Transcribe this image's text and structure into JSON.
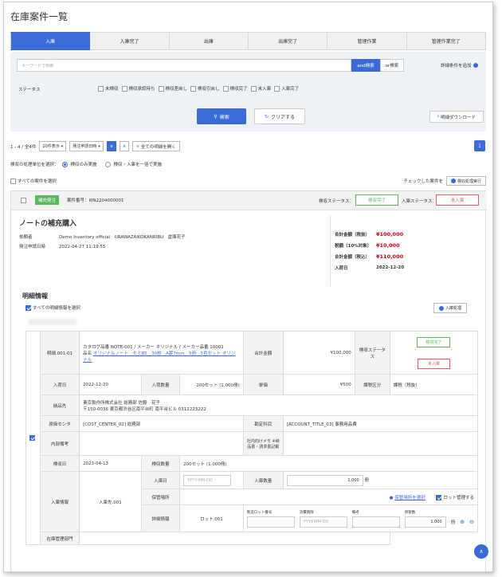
{
  "page": {
    "title": "在庫案件一覧"
  },
  "tabs": [
    {
      "label": "入庫"
    },
    {
      "label": "入庫完了"
    },
    {
      "label": "出庫"
    },
    {
      "label": "出庫完了"
    },
    {
      "label": "管理作業"
    },
    {
      "label": "管理作業完了"
    }
  ],
  "search": {
    "placeholder": "キーワードで検索",
    "and_label": "and検索",
    "or_label": "or検索",
    "advanced_label": "詳細条件を追加",
    "status_label": "ステータス",
    "status_options": [
      "未検収",
      "検収承認待ち",
      "検収差戻し",
      "検収引戻し",
      "検収完了",
      "未入庫",
      "入庫完了"
    ],
    "search_button": "検索",
    "clear_button": "クリアする",
    "download_button": "明細ダウンロード"
  },
  "listing": {
    "range_text": "1 - 4 / 全4件",
    "per_page": "20件表示",
    "sort": "発注申請日時",
    "open_all": "全ての明細を開く",
    "page_number": "1",
    "unit_label": "検収の処理単位を選択：",
    "unit_option_1": "検収のみ実施",
    "unit_option_2": "検収・入庫を一括で実施",
    "select_all_cases": "すべての案件を選択",
    "checked_cases": "チェックした案件を",
    "inspect_button": "検収処理実行"
  },
  "case": {
    "badge": "補充発注",
    "case_no": "案件番号：IIIN2204000001",
    "inspect_status_label": "検収ステータス：",
    "inspect_status": "検収完了",
    "receive_status_label": "入庫ステータス：",
    "receive_status": "未入庫",
    "title": "ノートの補充購入",
    "requester_label": "依頼者",
    "requester": "Demo Inventory official　URAWAZAIKOKANRIBU　倉庫花子",
    "ordered_at_label": "発注申請日時",
    "ordered_at": "2022-04-27 11:19:55",
    "totals": {
      "subtotal_label": "合計金額（税抜）",
      "subtotal": "¥100,000",
      "tax_label": "税額（10%対象）",
      "tax": "¥10,000",
      "total_label": "合計金額（税込）",
      "total": "¥110,000",
      "arrival_label": "入荷日",
      "arrival": "2022-12-20"
    }
  },
  "detail": {
    "heading": "明細情報",
    "select_all": "すべての明細情報を選択",
    "receive_button": "入庫処理",
    "row": {
      "detail_no_label": "明細.001-01",
      "product_line1": "カタログ品番 NOTE-001 / メーカー オリジナル / メーカー品番 10001",
      "product_name_prefix": "品名",
      "product_name": "オリジナルノート　セミB5　30枚　A罫7mm　5冊　5色セット オリジナル",
      "amount_label": "合計金額",
      "amount": "¥100,000",
      "inspect_status_label": "検収ステータス",
      "inspect_status": "検収完了",
      "receive_status_label": "入庫ステータス",
      "receive_status": "未入庫",
      "arrival_label": "入荷日",
      "arrival": "2022-12-20",
      "arrival_qty_label": "入荷数量",
      "arrival_qty": "200セット (1,000冊)",
      "unit_price_label": "単価",
      "unit_price": "¥500",
      "tax_class_label": "課税区分",
      "tax_class": "課税（税抜）",
      "delivery_label": "納品先",
      "delivery": "東京製作所株式会社 総務部 佐藤　花子",
      "delivery_address": "〒150-0036 東京都渋谷区南平台町 南平台ビル 0312223222",
      "cost_center_label": "原価センタ",
      "cost_center": "[COST_CENTER_02] 総務部",
      "account_label": "勘定科目",
      "account": "[ACCOUNT_TITLE_03] 事務用品費",
      "internal_note_label": "内部備考",
      "internal_note": "",
      "memo_label": "社内向けメモ ※納品書・請求書記載",
      "memo": "",
      "inspect_date_label": "検収日",
      "inspect_date": "2023-04-13",
      "inspect_qty_label": "検収数量",
      "inspect_qty": "200セット (1,000冊)",
      "receive_info_label": "入庫情報",
      "receive_dest": "入庫先.001",
      "receive_date_label": "入庫日",
      "receive_date_placeholder": "YYYY-MM-DD",
      "receive_qty_label": "入庫数量",
      "receive_qty": "1,000",
      "receive_qty_unit": "冊",
      "storage_label": "保管場所",
      "storage_link": "保管場所を選択",
      "lot_manage": "ロット管理する",
      "detail_info_label": "詳細情報",
      "lot_label": "ロット.001",
      "lot_no_label": "製造ロット番号",
      "exp_label": "消費期限",
      "note_label": "備考",
      "qty_label": "保管数",
      "exp_placeholder": "YYYY-MM-DD",
      "lot_qty": "1,000",
      "lot_qty_unit": "冊",
      "stock_dept_label": "在庫管理部門"
    }
  },
  "colors": {
    "accent": "#3a6bd6",
    "ok": "#5cb85c",
    "ng": "#e05a6a",
    "price": "#d0021b"
  }
}
